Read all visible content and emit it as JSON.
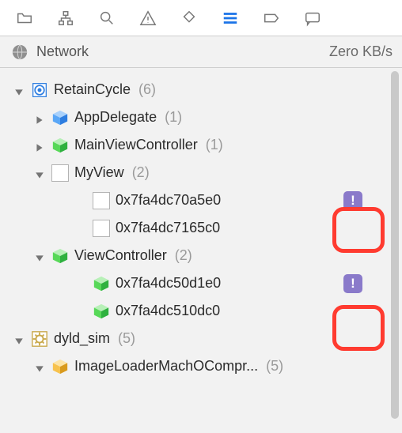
{
  "toolbar": {
    "icons": [
      "folder-icon",
      "hierarchy-icon",
      "search-icon",
      "warning-icon",
      "tag-shape-icon",
      "list-icon",
      "label-icon",
      "comment-icon"
    ],
    "active_index": 5
  },
  "header": {
    "title": "Network",
    "stat": "Zero KB/s"
  },
  "tree": {
    "root": {
      "label": "RetainCycle",
      "count": "(6)",
      "expanded": true,
      "children": [
        {
          "label": "AppDelegate",
          "count": "(1)",
          "expanded": false,
          "icon": "cube-blue"
        },
        {
          "label": "MainViewController",
          "count": "(1)",
          "expanded": false,
          "icon": "cube-green"
        },
        {
          "label": "MyView",
          "count": "(2)",
          "expanded": true,
          "icon": "checkbox",
          "children": [
            {
              "label": "0x7fa4dc70a5e0",
              "icon": "checkbox",
              "has_warning": true
            },
            {
              "label": "0x7fa4dc7165c0",
              "icon": "checkbox",
              "has_warning": false
            }
          ]
        },
        {
          "label": "ViewController",
          "count": "(2)",
          "expanded": true,
          "icon": "cube-green",
          "children": [
            {
              "label": "0x7fa4dc50d1e0",
              "icon": "cube-green",
              "has_warning": true
            },
            {
              "label": "0x7fa4dc510dc0",
              "icon": "cube-green",
              "has_warning": false
            }
          ]
        }
      ]
    },
    "second": {
      "label": "dyld_sim",
      "count": "(5)",
      "expanded": true,
      "icon": "gear",
      "children": [
        {
          "label": "ImageLoaderMachOCompr...",
          "count": "(5)",
          "expanded": true,
          "icon": "cube-yellow"
        }
      ]
    }
  },
  "colors": {
    "warning_badge": "#8a7aca",
    "callout": "#ff3b30"
  }
}
